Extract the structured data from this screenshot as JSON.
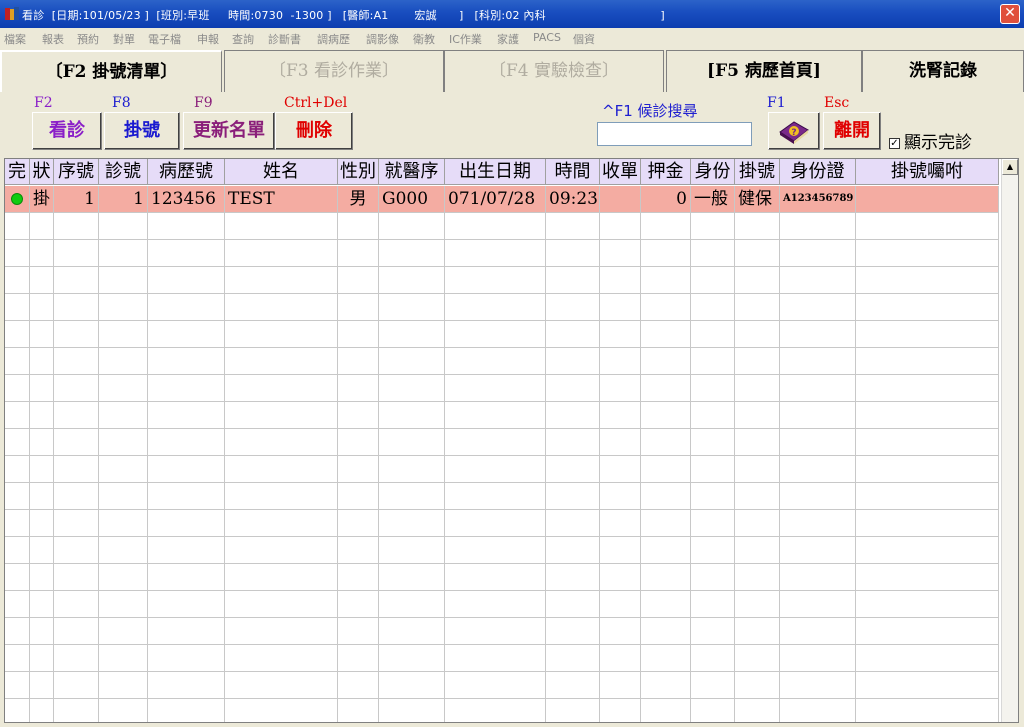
{
  "window": {
    "title": "看診  [日期:101/05/23 ]  [班別:早班     時間:0730  -1300 ]   [醫師:A1       宏誠      ]   [科別:02 內科                               ]",
    "close_symbol": "✕"
  },
  "menu": [
    "檔案",
    "報表",
    "預約",
    "對單",
    "電子檔",
    "申報",
    "查詢",
    "診斷書",
    "調病歷",
    "調影像",
    "衛教",
    "IC作業",
    "家護",
    "PACS",
    "個資"
  ],
  "tabs": [
    {
      "label": "〔F2 掛號清單〕",
      "state": "active"
    },
    {
      "label": "〔F3 看診作業〕",
      "state": "disabled"
    },
    {
      "label": "〔F4 實驗檢查〕",
      "state": "disabled"
    },
    {
      "label": "[F5 病歷首頁]",
      "state": "normal"
    },
    {
      "label": "洗腎記錄",
      "state": "normal"
    }
  ],
  "toolbar": {
    "buttons": [
      {
        "key": "F2",
        "label": "看診",
        "color": "#8a1fc8",
        "key_color": "#8a1fc8"
      },
      {
        "key": "F8",
        "label": "掛號",
        "color": "#1a1ad0",
        "key_color": "#1a1ad0"
      },
      {
        "key": "F9",
        "label": "更新名單",
        "color": "#8a1f7a",
        "key_color": "#8a1f7a"
      },
      {
        "key": "Ctrl+Del",
        "label": "刪除",
        "color": "#e00000",
        "key_color": "#e00000"
      }
    ],
    "search_label": "^F1 候診搜尋",
    "search_value": "",
    "help_key": "F1",
    "exit_key": "Esc",
    "exit_label": "離開",
    "show_done_label": "顯示完診",
    "show_done_checked": "✓"
  },
  "grid": {
    "columns": [
      "完",
      "狀",
      "序號",
      "診號",
      "病歷號",
      "姓名",
      "性別",
      "就醫序",
      "出生日期",
      "時間",
      "收單",
      "押金",
      "身份",
      "掛號",
      "身份證",
      "掛號囑咐"
    ],
    "rows": [
      {
        "done": "",
        "status": "掛",
        "seq": "1",
        "clinic_no": "1",
        "chart_no": "123456",
        "name": "TEST",
        "sex": "男",
        "visit_seq": "G000",
        "birth": "071/07/28",
        "time": "09:23",
        "receipt": "",
        "deposit": "0",
        "identity": "一般",
        "reg_type": "健保",
        "id_no": "A123456789",
        "note": ""
      }
    ],
    "status_dot_color": "#10cc10",
    "highlight_color": "#f4aca2"
  }
}
